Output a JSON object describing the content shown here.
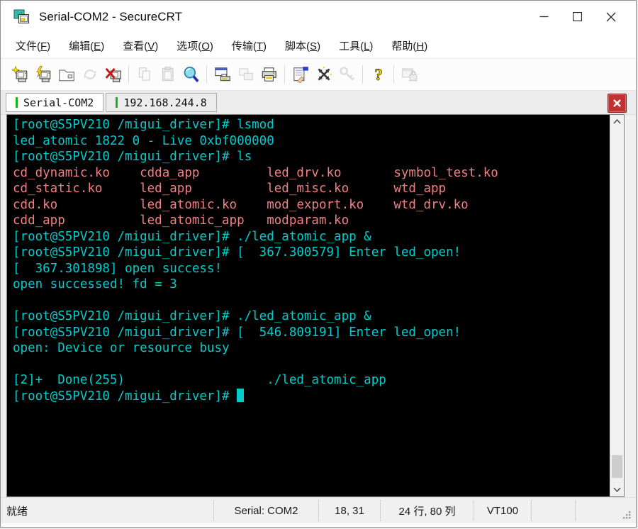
{
  "colors": {
    "terminal_cyan": "#00cccc",
    "terminal_red": "#f08080",
    "terminal_background": "#000000",
    "tab_indicator_green": "#1ab21a",
    "close_button_red": "#c43131"
  },
  "window": {
    "title": "Serial-COM2 - SecureCRT"
  },
  "menu": {
    "items": [
      {
        "name": "menu-item-file",
        "text": "文件",
        "key": "F"
      },
      {
        "name": "menu-item-edit",
        "text": "编辑",
        "key": "E"
      },
      {
        "name": "menu-item-view",
        "text": "查看",
        "key": "V"
      },
      {
        "name": "menu-item-options",
        "text": "选项",
        "key": "O"
      },
      {
        "name": "menu-item-transfer",
        "text": "传输",
        "key": "T"
      },
      {
        "name": "menu-item-script",
        "text": "脚本",
        "key": "S"
      },
      {
        "name": "menu-item-tools",
        "text": "工具",
        "key": "L"
      },
      {
        "name": "menu-item-help",
        "text": "帮助",
        "key": "H"
      }
    ]
  },
  "toolbar": {
    "items": [
      {
        "name": "new-session",
        "icon": "sym-new-session",
        "enabled": true
      },
      {
        "name": "quick-connect",
        "icon": "sym-quick-connect",
        "enabled": true
      },
      {
        "name": "connect-in-tab",
        "icon": "sym-connect-tab",
        "enabled": true
      },
      {
        "name": "reconnect",
        "icon": "sym-reconnect",
        "enabled": false
      },
      {
        "name": "disconnect",
        "icon": "sym-disconnect",
        "enabled": true
      },
      {
        "sep": true
      },
      {
        "name": "copy",
        "icon": "sym-copy",
        "enabled": false
      },
      {
        "name": "paste",
        "icon": "sym-paste",
        "enabled": false
      },
      {
        "name": "find",
        "icon": "sym-find",
        "enabled": true
      },
      {
        "sep": true
      },
      {
        "name": "print-screen",
        "icon": "sym-print-screen",
        "enabled": true
      },
      {
        "name": "print-selection",
        "icon": "sym-print-two",
        "enabled": false
      },
      {
        "name": "print",
        "icon": "sym-printer",
        "enabled": true
      },
      {
        "sep": true
      },
      {
        "name": "session-options",
        "icon": "sym-options",
        "enabled": true
      },
      {
        "name": "run-script",
        "icon": "sym-script",
        "enabled": true
      },
      {
        "name": "key-agent",
        "icon": "sym-key",
        "enabled": false
      },
      {
        "sep": true
      },
      {
        "name": "help",
        "icon": "sym-help",
        "enabled": true
      },
      {
        "sep": true
      },
      {
        "name": "lock-session",
        "icon": "sym-lock-window",
        "enabled": false
      }
    ]
  },
  "tabs": [
    {
      "name": "tab-serial-com2",
      "label": "Serial-COM2",
      "active": true
    },
    {
      "name": "tab-192-168-244-8",
      "label": "192.168.244.8",
      "active": false
    }
  ],
  "terminal": {
    "lines": [
      {
        "text": "[root@S5PV210 /migui_driver]# lsmod",
        "color": "cyan"
      },
      {
        "text": "led_atomic 1822 0 - Live 0xbf000000",
        "color": "cyan"
      },
      {
        "text": "[root@S5PV210 /migui_driver]# ls",
        "color": "cyan"
      },
      {
        "text": "cd_dynamic.ko    cdda_app         led_drv.ko       symbol_test.ko",
        "color": "red"
      },
      {
        "text": "cd_static.ko     led_app          led_misc.ko      wtd_app",
        "color": "red"
      },
      {
        "text": "cdd.ko           led_atomic.ko    mod_export.ko    wtd_drv.ko",
        "color": "red"
      },
      {
        "text": "cdd_app          led_atomic_app   modparam.ko",
        "color": "red"
      },
      {
        "text": "[root@S5PV210 /migui_driver]# ./led_atomic_app &",
        "color": "cyan"
      },
      {
        "text": "[root@S5PV210 /migui_driver]# [  367.300579] Enter led_open!",
        "color": "cyan"
      },
      {
        "text": "[  367.301898] open success!",
        "color": "cyan"
      },
      {
        "text": "open successed! fd = 3",
        "color": "cyan"
      },
      {
        "text": "",
        "color": "cyan"
      },
      {
        "text": "[root@S5PV210 /migui_driver]# ./led_atomic_app &",
        "color": "cyan"
      },
      {
        "text": "[root@S5PV210 /migui_driver]# [  546.809191] Enter led_open!",
        "color": "cyan"
      },
      {
        "text": "open: Device or resource busy",
        "color": "cyan"
      },
      {
        "text": "",
        "color": "cyan"
      },
      {
        "text": "[2]+  Done(255)                   ./led_atomic_app",
        "color": "cyan"
      },
      {
        "text": "[root@S5PV210 /migui_driver]# ",
        "color": "cyan",
        "cursor": true
      }
    ]
  },
  "statusbar": {
    "cells": [
      {
        "name": "status-ready",
        "label": "就绪",
        "grow": true
      },
      {
        "name": "status-serial",
        "label": "Serial: COM2"
      },
      {
        "name": "status-cursor-position",
        "label": "18, 31"
      },
      {
        "name": "status-terminal-size",
        "label": "24 行, 80 列"
      },
      {
        "name": "status-emulation",
        "label": "VT100"
      },
      {
        "name": "status-empty-1",
        "label": ""
      },
      {
        "name": "status-empty-2",
        "label": ""
      }
    ]
  }
}
